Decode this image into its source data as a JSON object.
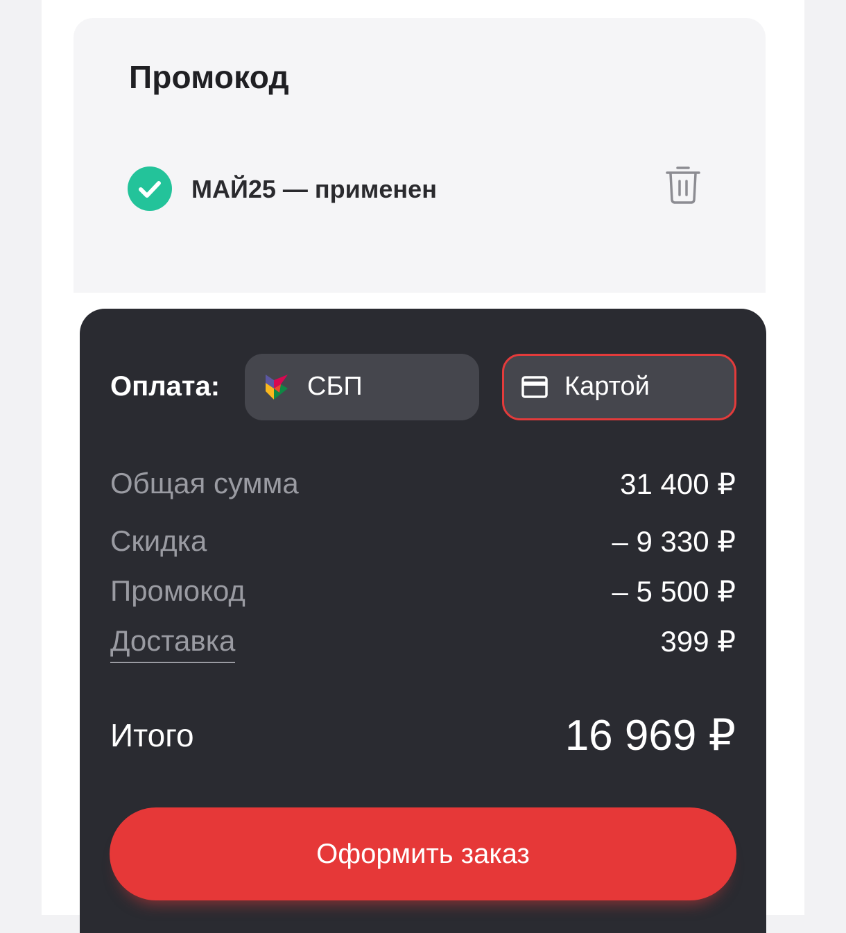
{
  "promo": {
    "title": "Промокод",
    "code": "МАЙ25",
    "status_text": "МАЙ25 — применен",
    "check_icon": "check-circle-icon",
    "delete_icon": "trash-icon",
    "accent_color": "#23c39a"
  },
  "payment": {
    "label": "Оплата:",
    "options": [
      {
        "label": "СБП",
        "icon": "sbp-logo-icon",
        "selected": false
      },
      {
        "label": "Картой",
        "icon": "credit-card-icon",
        "selected": true
      }
    ],
    "selected_border_color": "#e33b3b"
  },
  "summary": {
    "lines": [
      {
        "label": "Общая сумма",
        "value": "31 400 ₽"
      },
      {
        "label": "Скидка",
        "value": "– 9 330 ₽"
      },
      {
        "label": "Промокод",
        "value": "– 5 500 ₽"
      },
      {
        "label": "Доставка",
        "value": "399 ₽"
      }
    ],
    "total_label": "Итого",
    "total_value": "16 969 ₽"
  },
  "checkout": {
    "button_label": "Оформить заказ",
    "button_color": "#e63838"
  },
  "colors": {
    "dark_panel": "#2a2b31",
    "light_panel": "#f5f5f7"
  }
}
